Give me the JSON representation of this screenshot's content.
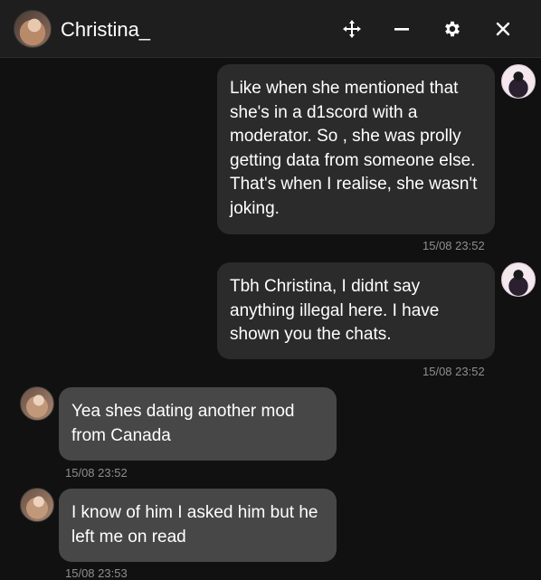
{
  "header": {
    "contact_name": "Christina_",
    "icons": [
      "move-icon",
      "minimize-icon",
      "gear-icon",
      "close-icon"
    ]
  },
  "messages": [
    {
      "direction": "outgoing",
      "text": "Like when she mentioned that she's in a d1scord with a moderator. So , she was prolly getting data from someone else. That's when I realise, she wasn't joking.",
      "time": "15/08 23:52"
    },
    {
      "direction": "outgoing",
      "text": "Tbh Christina, I didnt say anything illegal here. I have shown you the chats.",
      "time": "15/08 23:52"
    },
    {
      "direction": "incoming",
      "text": "Yea shes dating another mod from Canada",
      "time": "15/08 23:52"
    },
    {
      "direction": "incoming",
      "text": "I know of him I asked him but he left me on read",
      "time": "15/08 23:53"
    }
  ],
  "colors": {
    "background": "#111111",
    "header": "#1e1e1e",
    "outgoing_bubble": "#2b2b2b",
    "incoming_bubble": "#474747",
    "timestamp": "#8e8e8e"
  }
}
